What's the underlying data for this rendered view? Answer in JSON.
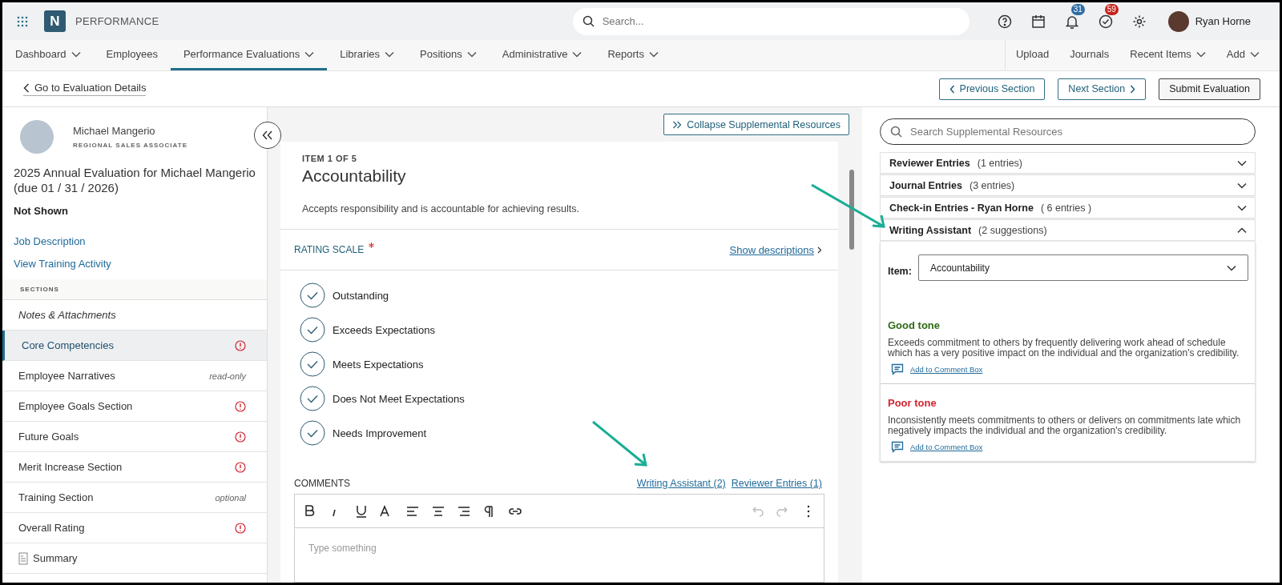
{
  "app": {
    "logo_letter": "N",
    "title": "PERFORMANCE"
  },
  "search": {
    "placeholder": "Search..."
  },
  "header_icons": [
    {
      "kind": "help"
    },
    {
      "kind": "calendar"
    },
    {
      "kind": "bell",
      "badge": "31",
      "color": "#2e6da4"
    },
    {
      "kind": "task",
      "badge": "59",
      "color": "#c8231d"
    },
    {
      "kind": "settings"
    }
  ],
  "user": {
    "name": "Ryan Horne"
  },
  "nav": [
    {
      "label": "Dashboard",
      "dropdown": true,
      "selected": false
    },
    {
      "label": "Employees",
      "dropdown": false,
      "selected": false
    },
    {
      "label": "Performance Evaluations",
      "dropdown": true,
      "selected": true
    },
    {
      "label": "Libraries",
      "dropdown": true,
      "selected": false
    },
    {
      "label": "Positions",
      "dropdown": true,
      "selected": false
    },
    {
      "label": "Administrative",
      "dropdown": true,
      "selected": false
    },
    {
      "label": "Reports",
      "dropdown": true,
      "selected": false
    }
  ],
  "nav_right": [
    {
      "label": "Upload",
      "dropdown": false
    },
    {
      "label": "Journals",
      "dropdown": false
    },
    {
      "label": "Recent Items",
      "dropdown": true
    },
    {
      "label": "Add",
      "dropdown": true
    }
  ],
  "back_link": "Go to Evaluation Details",
  "actions": [
    {
      "label": "Previous Section",
      "kind": "prev"
    },
    {
      "label": "Next Section",
      "kind": "next"
    },
    {
      "label": "Submit Evaluation",
      "kind": "submit"
    }
  ],
  "employee": {
    "name": "Michael Mangerio",
    "role": "REGIONAL SALES ASSOCIATE"
  },
  "evaluation_title": "2025 Annual Evaluation for Michael Mangerio (due 01 / 31 / 2026)",
  "visibility": "Not Shown",
  "links": [
    "Job Description",
    "View Training Activity"
  ],
  "sections_heading": "SECTIONS",
  "sections": [
    {
      "label": "Notes & Attachments",
      "kind": "attachments",
      "selected": false,
      "alert": false
    },
    {
      "label": "Core Competencies",
      "kind": "section",
      "selected": true,
      "alert": true
    },
    {
      "label": "Employee Narratives",
      "kind": "section",
      "selected": false,
      "alert": false,
      "note": "read-only"
    },
    {
      "label": "Employee Goals Section",
      "kind": "section",
      "selected": false,
      "alert": true
    },
    {
      "label": "Future Goals",
      "kind": "section",
      "selected": false,
      "alert": true
    },
    {
      "label": "Merit Increase Section",
      "kind": "section",
      "selected": false,
      "alert": true
    },
    {
      "label": "Training Section",
      "kind": "section",
      "selected": false,
      "alert": false,
      "note": "optional"
    },
    {
      "label": "Overall Rating",
      "kind": "section",
      "selected": false,
      "alert": true
    },
    {
      "label": "Summary",
      "kind": "summary",
      "selected": false,
      "alert": false
    }
  ],
  "collapse_button": "Collapse Supplemental Resources",
  "item": {
    "counter": "ITEM 1 OF 5",
    "title": "Accountability",
    "description": "Accepts responsibility and is accountable for achieving results."
  },
  "rating": {
    "label": "RATING SCALE",
    "required": true,
    "show_link": "Show descriptions",
    "options": [
      {
        "label": "Outstanding",
        "selected": false
      },
      {
        "label": "Exceeds Expectations",
        "selected": false
      },
      {
        "label": "Meets Expectations",
        "selected": false
      },
      {
        "label": "Does Not Meet Expectations",
        "selected": false
      },
      {
        "label": "Needs Improvement",
        "selected": false
      }
    ]
  },
  "comments": {
    "label": "COMMENTS",
    "links": [
      "Writing Assistant (2)",
      "Reviewer Entries (1)"
    ],
    "placeholder": "Type something"
  },
  "resources": {
    "search_placeholder": "Search Supplemental Resources",
    "panels": [
      {
        "title": "Reviewer Entries",
        "count": "(1 entries)",
        "expanded": false
      },
      {
        "title": "Journal Entries",
        "count": "(3 entries)",
        "expanded": false
      },
      {
        "title": "Check-in Entries - Ryan Horne",
        "count": "( 6 entries )",
        "expanded": false
      },
      {
        "title": "Writing Assistant",
        "count": "(2 suggestions)",
        "expanded": true
      }
    ],
    "item_label": "Item:",
    "item_value": "Accountability",
    "suggestions": [
      {
        "tone": "Good tone",
        "kind": "good",
        "text": "Exceeds commitment to others by frequently delivering work ahead of schedule which has a very positive impact on the individual and the organization's credibility.",
        "action": "Add to Comment Box"
      },
      {
        "tone": "Poor tone",
        "kind": "poor",
        "text": "Inconsistently meets commitments to others or delivers on commitments late which negatively impacts the individual and the organization's credibility.",
        "action": "Add to Comment Box"
      }
    ]
  }
}
